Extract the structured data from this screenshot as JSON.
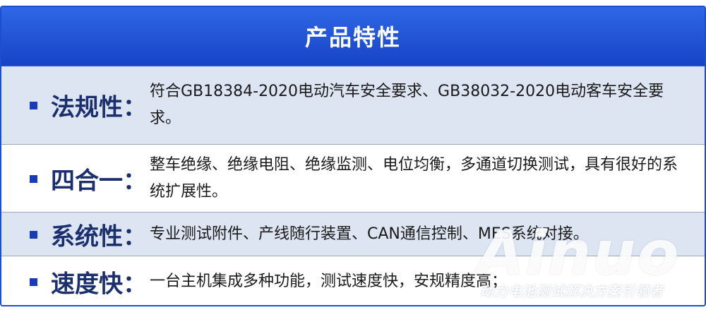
{
  "header": {
    "title": "产品特性"
  },
  "rows": [
    {
      "label": "法规性：",
      "text": "符合GB18384-2020电动汽车安全要求、GB38032-2020电动客车安全要求。"
    },
    {
      "label": "四合一：",
      "text": "整车绝缘、绝缘电阻、绝缘监测、电位均衡，多通道切换测试，具有很好的系统扩展性。"
    },
    {
      "label": "系统性：",
      "text": "专业测试附件、产线随行装置、CAN通信控制、MES系统对接。"
    },
    {
      "label": "速度快：",
      "text": "一台主机集成多种功能，测试速度快，安规精度高；"
    }
  ],
  "watermark": {
    "brand": "Ainuo",
    "slogan": "动力电池测试解决方案引领者"
  },
  "colors": {
    "header_bg": "#1c4fd0",
    "label": "#1b2f6e",
    "bullet": "#1a3bb8",
    "shaded_row": "#dde4f2"
  }
}
